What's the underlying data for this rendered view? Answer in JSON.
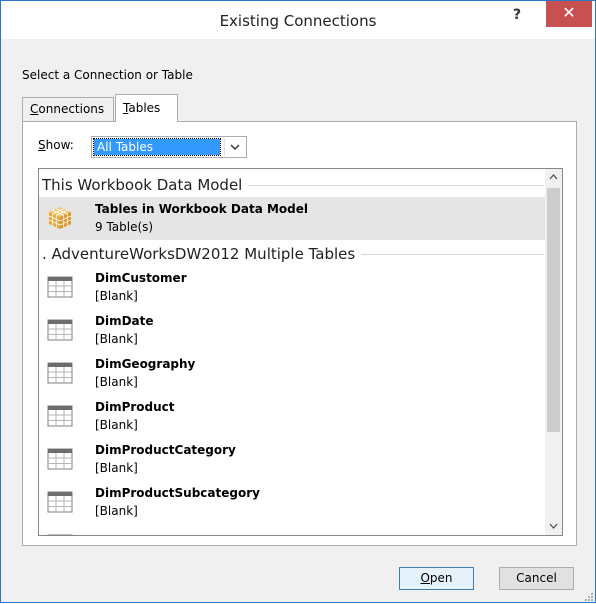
{
  "window": {
    "title": "Existing Connections",
    "help_label": "?",
    "close_label": "✕"
  },
  "prompt": "Select a Connection or Table",
  "tabs": [
    {
      "label_prefix": "",
      "label_mnemonic": "C",
      "label_rest": "onnections"
    },
    {
      "label_prefix": "",
      "label_mnemonic": "T",
      "label_rest": "ables"
    }
  ],
  "show": {
    "label_mnemonic": "S",
    "label_rest": "how:",
    "selected_value": "All Tables"
  },
  "groups": [
    {
      "header": "This Workbook Data Model"
    },
    {
      "header": ". AdventureWorksDW2012 Multiple Tables"
    }
  ],
  "items": [
    {
      "name": "Tables in Workbook Data Model",
      "sub": "9 Table(s)",
      "icon": "cube-icon",
      "selected": true
    },
    {
      "name": "DimCustomer",
      "sub": "[Blank]",
      "icon": "table-icon"
    },
    {
      "name": "DimDate",
      "sub": "[Blank]",
      "icon": "table-icon"
    },
    {
      "name": "DimGeography",
      "sub": "[Blank]",
      "icon": "table-icon"
    },
    {
      "name": "DimProduct",
      "sub": "[Blank]",
      "icon": "table-icon"
    },
    {
      "name": "DimProductCategory",
      "sub": "[Blank]",
      "icon": "table-icon"
    },
    {
      "name": "DimProductSubcategory",
      "sub": "[Blank]",
      "icon": "table-icon"
    }
  ],
  "buttons": {
    "open_mnemonic": "O",
    "open_rest": "pen",
    "cancel": "Cancel"
  },
  "colors": {
    "accent": "#2b79c4",
    "close": "#c75050",
    "selection": "#3399ff"
  }
}
